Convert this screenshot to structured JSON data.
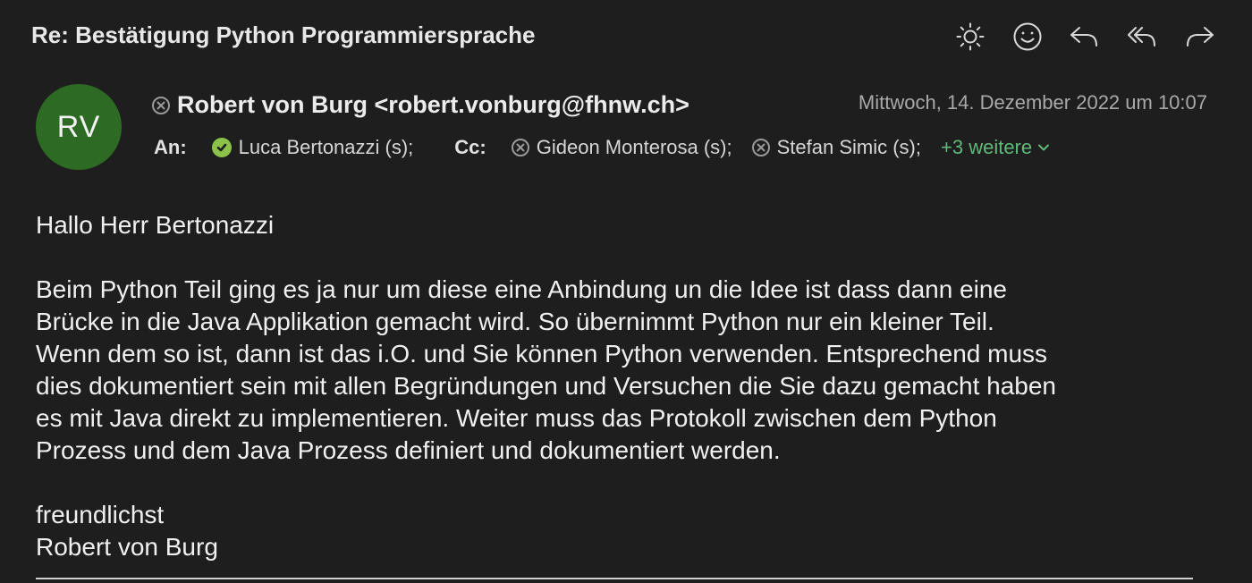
{
  "message": {
    "subject": "Re: Bestätigung Python Programmiersprache",
    "sender": {
      "initials": "RV",
      "display": "Robert von Burg <robert.vonburg@fhnw.ch>",
      "avatar_color": "#2d6a23"
    },
    "date": "Mittwoch, 14. Dezember 2022 um 10:07",
    "to_label": "An:",
    "to": [
      {
        "name": "Luca Bertonazzi (s);",
        "status_icon": "verified-check-icon"
      }
    ],
    "cc_label": "Cc:",
    "cc": [
      {
        "name": "Gideon Monterosa (s);",
        "status_icon": "unverified-x-icon"
      },
      {
        "name": "Stefan Simic (s);",
        "status_icon": "unverified-x-icon"
      }
    ],
    "more_recipients": "+3 weitere",
    "body": {
      "greeting": "Hallo Herr Bertonazzi",
      "lines": [
        "Beim Python Teil ging es ja nur um diese eine Anbindung un die Idee ist dass dann eine",
        "Brücke in die Java Applikation gemacht wird. So übernimmt Python nur ein kleiner Teil.",
        "Wenn dem so ist, dann ist das i.O. und Sie können Python verwenden. Entsprechend muss",
        "dies dokumentiert sein mit allen Begründungen und Versuchen die Sie dazu gemacht haben",
        "es mit Java direkt zu implementieren. Weiter muss das Protokoll zwischen dem Python",
        "Prozess und dem Java Prozess definiert und dokumentiert werden."
      ],
      "closing": "freundlichst",
      "signature": "Robert von Burg"
    }
  },
  "toolbar": {
    "icons": [
      "brightness-icon",
      "emoji-reaction-icon",
      "reply-icon",
      "reply-all-icon",
      "forward-icon"
    ]
  },
  "colors": {
    "background": "#1e1e1e",
    "accent_green": "#5fb97a",
    "verified_green": "#8bc34a"
  }
}
